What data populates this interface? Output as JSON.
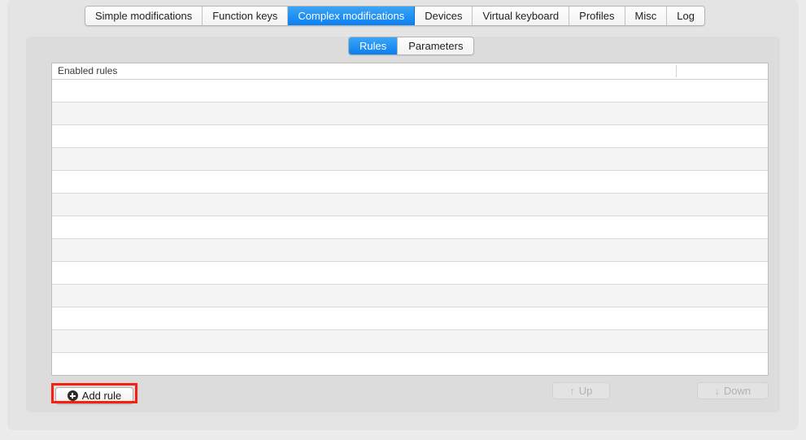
{
  "window": {
    "tabs": [
      {
        "label": "Simple modifications",
        "active": false
      },
      {
        "label": "Function keys",
        "active": false
      },
      {
        "label": "Complex modifications",
        "active": true
      },
      {
        "label": "Devices",
        "active": false
      },
      {
        "label": "Virtual keyboard",
        "active": false
      },
      {
        "label": "Profiles",
        "active": false
      },
      {
        "label": "Misc",
        "active": false
      },
      {
        "label": "Log",
        "active": false
      }
    ]
  },
  "segmented_control": {
    "segments": [
      {
        "label": "Rules",
        "active": true
      },
      {
        "label": "Parameters",
        "active": false
      }
    ]
  },
  "table": {
    "columns": [
      {
        "label": "Enabled rules"
      },
      {
        "label": ""
      }
    ],
    "rows": [],
    "empty_row_count": 13
  },
  "buttons": {
    "add_rule": {
      "label": "Add rule",
      "icon": "plus-circle-icon",
      "enabled": true
    },
    "up": {
      "label": "Up",
      "icon": "arrow-up-icon",
      "glyph": "↑",
      "enabled": false
    },
    "down": {
      "label": "Down",
      "icon": "arrow-down-icon",
      "glyph": "↓",
      "enabled": false
    }
  },
  "annotation": {
    "highlight_color": "#fb1d10",
    "target": "add-rule-button"
  },
  "colors": {
    "accent": "#0a7ff0",
    "window_background": "#e4e4e4",
    "card_background": "#dcdcdc",
    "page_background": "#ececec",
    "row_alt": "#f4f4f4"
  }
}
